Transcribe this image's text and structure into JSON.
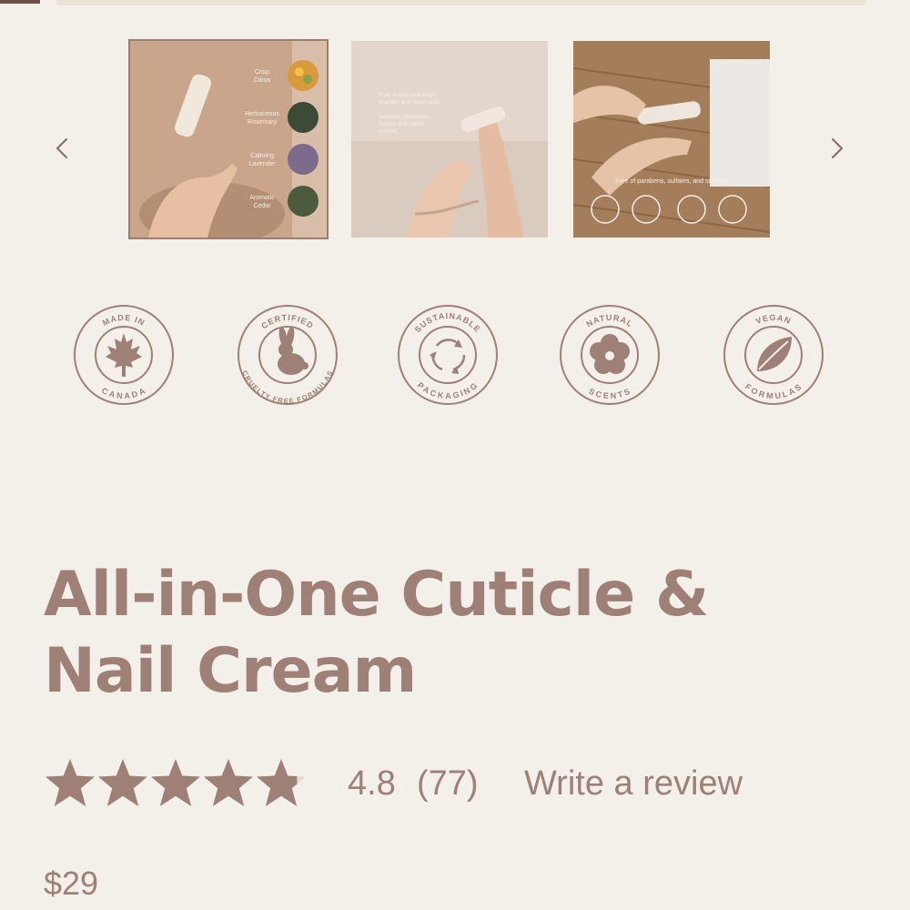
{
  "carousel": {
    "images": [
      {
        "alt": "PAUME",
        "labels": [
          {
            "line1": "Crisp",
            "line2": "Citrus"
          },
          {
            "line1": "Herbaceous",
            "line2": "Rosemary"
          },
          {
            "line1": "Calming",
            "line2": "Lavender"
          },
          {
            "line1": "Aromatic",
            "line2": "Cedar"
          }
        ]
      },
      {
        "alt": "PAUME",
        "text1": "Plant Keratin and Biotin",
        "text1b": "strength, and repair nails.",
        "text2": "Safflower Oleosomes",
        "text2b": "hydrate and soften",
        "text2c": "cuticles."
      },
      {
        "alt": "PAUME",
        "caption": "Free of parabens, sulfates, and silicones."
      }
    ]
  },
  "badges": [
    {
      "top": "MADE IN",
      "bottom": "CANADA",
      "icon": "maple-leaf-icon"
    },
    {
      "top": "CERTIFIED",
      "bottom": "CRUELTY FREE FORMULAS",
      "icon": "bunny-icon"
    },
    {
      "top": "SUSTAINABLE",
      "bottom": "PACKAGING",
      "icon": "recycle-icon"
    },
    {
      "top": "NATURAL",
      "bottom": "SCENTS",
      "icon": "flower-icon"
    },
    {
      "top": "VEGAN",
      "bottom": "FORMULAS",
      "icon": "leaf-icon"
    }
  ],
  "product": {
    "title_line1": "All-in-One Cuticle &",
    "title_line2": "Nail Cream",
    "rating": "4.8",
    "rating_value": 4.8,
    "rating_max": 5,
    "review_count": "(77)",
    "write_review": "Write a review",
    "price": "$29"
  },
  "colors": {
    "background": "#f3efe9",
    "accent": "#9e8076",
    "star_fill": "#9e8076",
    "star_empty": "#e7ddd2"
  }
}
